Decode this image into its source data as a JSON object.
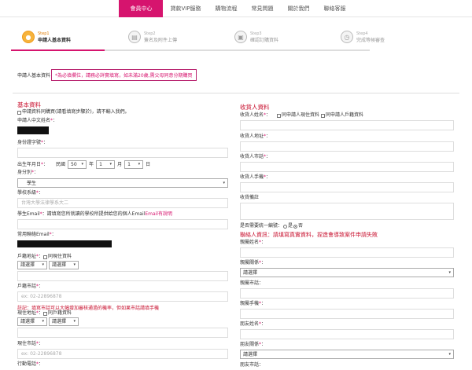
{
  "nav": {
    "items": [
      {
        "label": "會員中心",
        "active": true
      },
      {
        "label": "貸款VIP服務",
        "active": false
      },
      {
        "label": "購物流程",
        "active": false
      },
      {
        "label": "常見問題",
        "active": false
      },
      {
        "label": "關於我們",
        "active": false
      },
      {
        "label": "聯絡客服",
        "active": false
      }
    ]
  },
  "steps": [
    {
      "num": "Step1",
      "name": "申請人基本資料"
    },
    {
      "num": "Step2",
      "name": "簽名及附件上傳"
    },
    {
      "num": "Step3",
      "name": "確認訂購資料"
    },
    {
      "num": "Step4",
      "name": "完成等候審查"
    }
  ],
  "notice": {
    "label": "申請人基本資料",
    "text": "*為必填欄位，請務必詳實填寫，如未滿20歲,需父母同意分期購買"
  },
  "left": {
    "title": "基本資料",
    "same_check": "申請資料同購買(請看填寫步驟於)，請不輸入我們。",
    "name_label": "申請人中文姓名",
    "id_label": "身份證字號",
    "birth_label": "出生年月日",
    "birth_era": "民國",
    "birth_year": "50",
    "birth_year_unit": "年",
    "birth_month": "1",
    "birth_month_unit": "月",
    "birth_day": "1",
    "birth_day_unit": "日",
    "identity_label": "身分別",
    "identity_value": "學生",
    "school_label": "學校系級",
    "school_placeholder": "台灣大學法律學系大二",
    "school_email_label": "學生Email",
    "school_email_note": "：請填寫您所就讀的學校所提供給您的個人Email",
    "school_email_link": "Email有說明",
    "email_label": "常用聯絡Email",
    "household_label": "戶籍地址",
    "same_current": "同現住資料",
    "city_select": "請選擇",
    "district_select": "請選擇",
    "household_phone_label": "戶籍市話",
    "household_phone_placeholder": "ex: 02-22896878",
    "phone_note": "註記：填寫市話可以大幅增加審核通過的機率，但如果市話請填手機",
    "current_addr_label": "現住地址",
    "same_household": "同戶籍資料",
    "current_phone_label": "現住市話",
    "current_phone_placeholder": "ex: 02-22896878",
    "mobile_label": "行動電話"
  },
  "right": {
    "title": "收貨人資料",
    "receiver_name_label": "收貨人姓名",
    "same_current_opt": "同申請人現住資料",
    "same_household_opt": "同申請人戶籍資料",
    "receiver_addr_label": "收貨人地址",
    "receiver_phone_label": "收貨人市話",
    "receiver_mobile_label": "收貨人手機",
    "receiver_note_label": "收貨備註",
    "gift_label": "是否需要統一編號",
    "gift_yes": "是",
    "gift_no": "否",
    "contact_title": "聯絡人資訊：",
    "contact_warn": "請填寫真實資料，捏造會導致案件申請失敗",
    "contact1_name_label": "親屬姓名",
    "contact1_rel_label": "親屬關係",
    "contact1_rel_select": "請選擇",
    "contact1_phone_label": "親屬市話",
    "contact1_mobile_label": "親屬手機",
    "friend_name_label": "朋友姓名",
    "friend_rel_label": "朋友關係",
    "friend_rel_select": "請選擇",
    "friend_phone_label": "朋友市話"
  }
}
